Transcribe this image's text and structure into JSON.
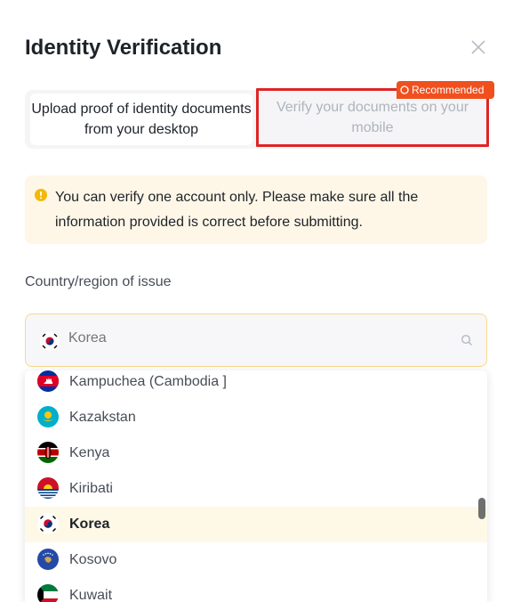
{
  "dialog": {
    "title": "Identity Verification",
    "close_icon": "close-icon"
  },
  "tabs": {
    "desktop_label": "Upload proof of identity documents from your desktop",
    "mobile_label": "Verify your documents on your mobile",
    "badge_label": "Recommended"
  },
  "notice": {
    "icon": "warning-icon",
    "text": "You can verify one account only. Please make sure all the information provided is correct before submitting."
  },
  "country": {
    "label": "Country/region of issue",
    "placeholder": "Korea",
    "selected_flag": "korea-flag-icon",
    "search_icon": "search-icon"
  },
  "options": [
    {
      "name": "Kampuchea (Cambodia ]",
      "flag": "cambodia"
    },
    {
      "name": "Kazakstan",
      "flag": "kazakhstan"
    },
    {
      "name": "Kenya",
      "flag": "kenya"
    },
    {
      "name": "Kiribati",
      "flag": "kiribati"
    },
    {
      "name": "Korea",
      "flag": "korea",
      "selected": true
    },
    {
      "name": "Kosovo",
      "flag": "kosovo"
    },
    {
      "name": "Kuwait",
      "flag": "kuwait"
    }
  ],
  "colors": {
    "accent": "#f0b90b",
    "badge": "#f0501e",
    "highlight_border": "#e02424",
    "notice_bg": "#fef6e7",
    "selected_bg": "#fef9e6"
  }
}
